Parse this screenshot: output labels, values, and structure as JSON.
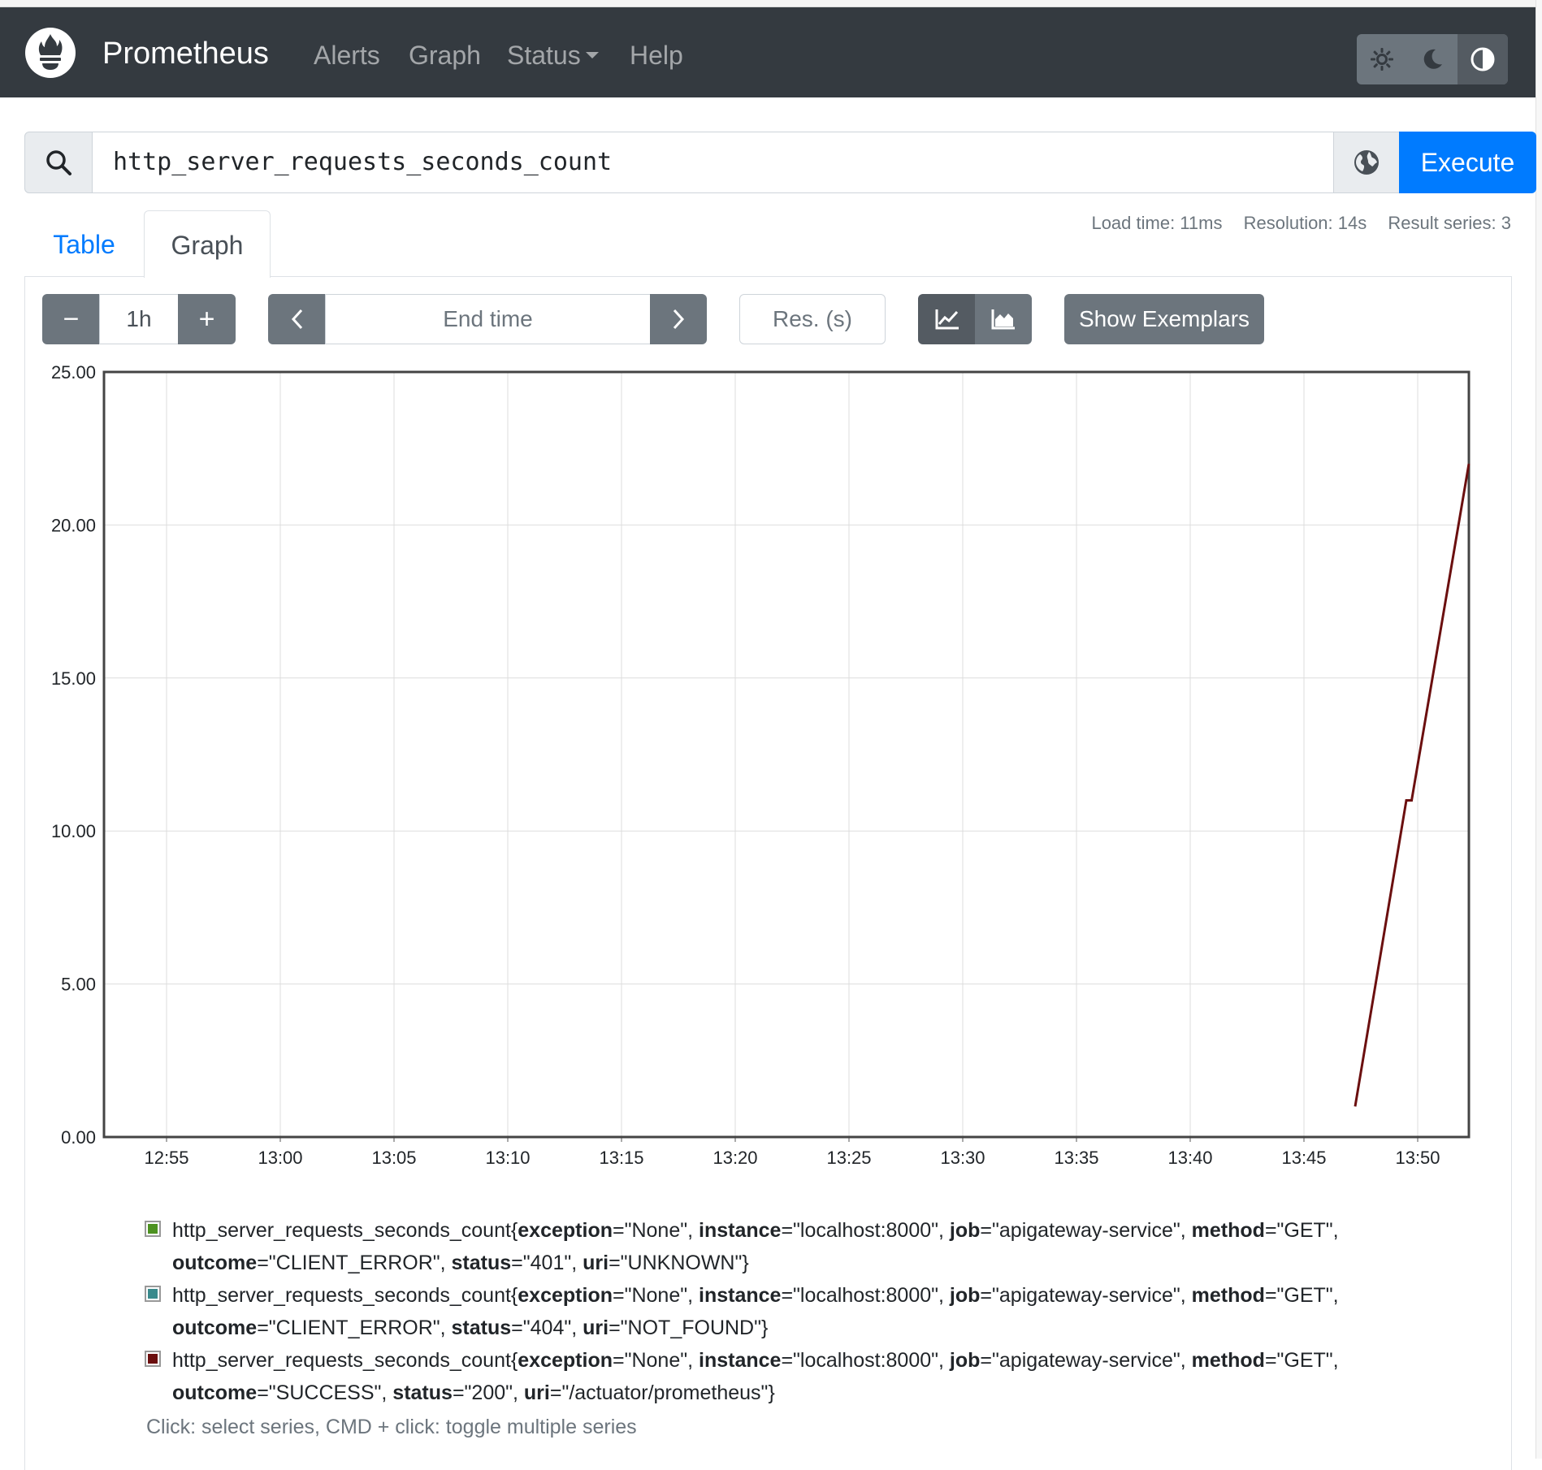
{
  "nav": {
    "brand": "Prometheus",
    "links": [
      "Alerts",
      "Graph",
      "Status",
      "Help"
    ]
  },
  "expression": {
    "query": "http_server_requests_seconds_count",
    "execute_label": "Execute"
  },
  "tabs": [
    "Table",
    "Graph"
  ],
  "stats": {
    "load_time": "Load time: 11ms",
    "resolution": "Resolution: 14s",
    "result_series": "Result series: 3"
  },
  "controls": {
    "minus": "−",
    "range": "1h",
    "plus": "+",
    "end_time_placeholder": "End time",
    "res_placeholder": "Res. (s)",
    "show_exemplars": "Show Exemplars"
  },
  "colors": {
    "navbar": "#343a40",
    "primary": "#007bff",
    "series_green": "#4d9221",
    "series_teal": "#3a8a8c",
    "series_red": "#6b0f0f"
  },
  "chart_data": {
    "type": "line",
    "x_tick_labels": [
      "12:55",
      "13:00",
      "13:05",
      "13:10",
      "13:15",
      "13:20",
      "13:25",
      "13:30",
      "13:35",
      "13:40",
      "13:45",
      "13:50"
    ],
    "y_tick_labels": [
      "0.00",
      "5.00",
      "10.00",
      "15.00",
      "20.00",
      "25.00"
    ],
    "ylim": [
      0,
      25
    ],
    "xlim": [
      "12:52:15",
      "13:52:15"
    ],
    "grid": true,
    "series": [
      {
        "name": "http_server_requests_seconds_count{exception=\"None\", instance=\"localhost:8000\", job=\"apigateway-service\", method=\"GET\", outcome=\"SUCCESS\", status=\"200\", uri=\"/actuator/prometheus\"}",
        "color": "#6b0f0f",
        "points": [
          {
            "x": "13:47:15",
            "y": 1
          },
          {
            "x": "13:49:30",
            "y": 11
          },
          {
            "x": "13:49:44",
            "y": 11
          },
          {
            "x": "13:52:15",
            "y": 22
          }
        ]
      }
    ]
  },
  "legend": [
    {
      "color": "#4d9221",
      "metric": "http_server_requests_seconds_count",
      "labels": [
        {
          "k": "exception",
          "v": "\"None\""
        },
        {
          "k": "instance",
          "v": "\"localhost:8000\""
        },
        {
          "k": "job",
          "v": "\"apigateway-service\""
        },
        {
          "k": "method",
          "v": "\"GET\""
        },
        {
          "k": "outcome",
          "v": "\"CLIENT_ERROR\""
        },
        {
          "k": "status",
          "v": "\"401\""
        },
        {
          "k": "uri",
          "v": "\"UNKNOWN\""
        }
      ]
    },
    {
      "color": "#3a8a8c",
      "metric": "http_server_requests_seconds_count",
      "labels": [
        {
          "k": "exception",
          "v": "\"None\""
        },
        {
          "k": "instance",
          "v": "\"localhost:8000\""
        },
        {
          "k": "job",
          "v": "\"apigateway-service\""
        },
        {
          "k": "method",
          "v": "\"GET\""
        },
        {
          "k": "outcome",
          "v": "\"CLIENT_ERROR\""
        },
        {
          "k": "status",
          "v": "\"404\""
        },
        {
          "k": "uri",
          "v": "\"NOT_FOUND\""
        }
      ]
    },
    {
      "color": "#6b0f0f",
      "metric": "http_server_requests_seconds_count",
      "labels": [
        {
          "k": "exception",
          "v": "\"None\""
        },
        {
          "k": "instance",
          "v": "\"localhost:8000\""
        },
        {
          "k": "job",
          "v": "\"apigateway-service\""
        },
        {
          "k": "method",
          "v": "\"GET\""
        },
        {
          "k": "outcome",
          "v": "\"SUCCESS\""
        },
        {
          "k": "status",
          "v": "\"200\""
        },
        {
          "k": "uri",
          "v": "\"/actuator/prometheus\""
        }
      ]
    }
  ],
  "hint": "Click: select series, CMD + click: toggle multiple series"
}
